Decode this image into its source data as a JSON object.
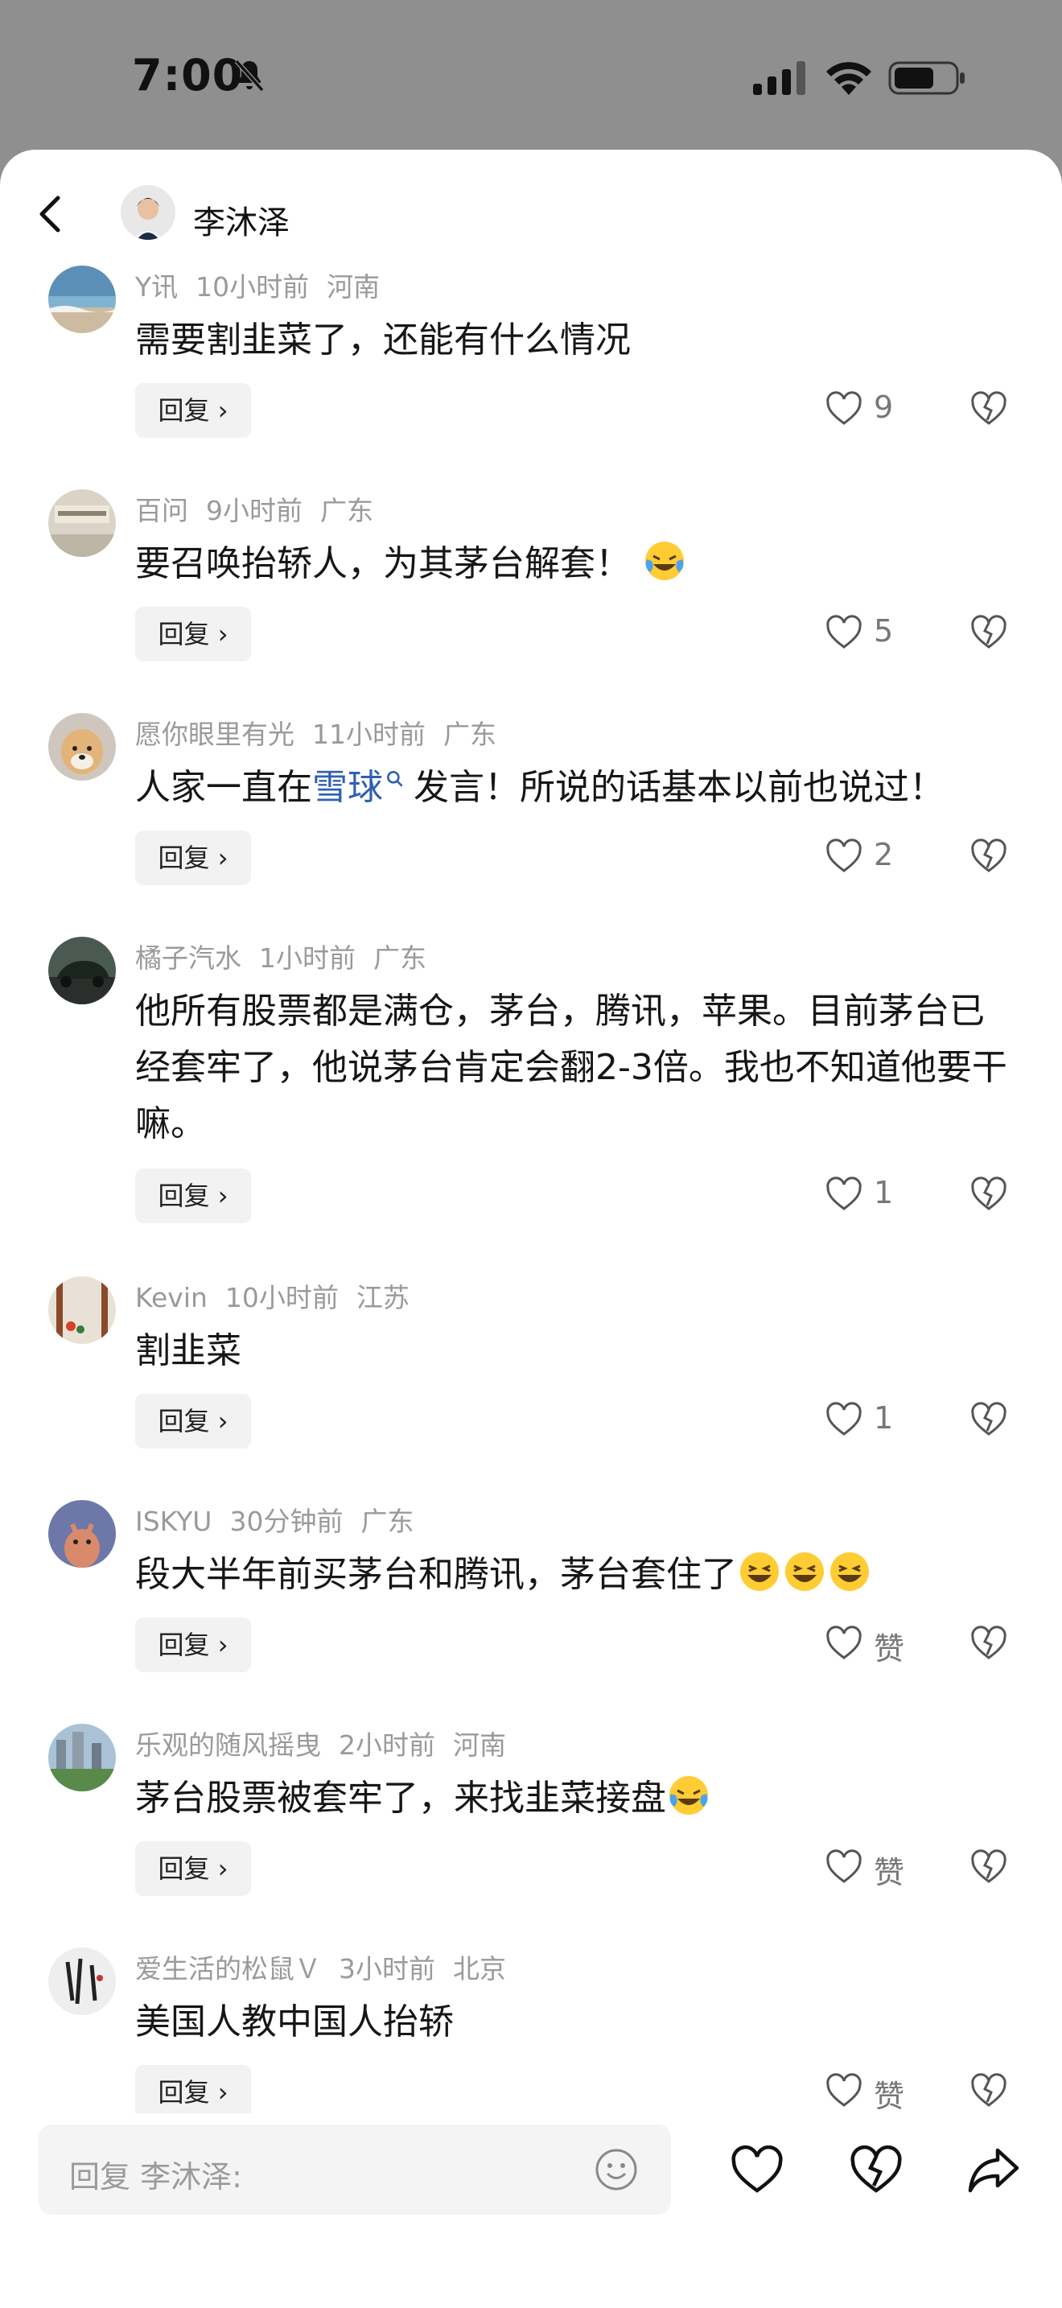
{
  "status": {
    "time": "7:00"
  },
  "header": {
    "name": "李沐泽"
  },
  "comments": [
    {
      "user": "Y讯",
      "time": "10小时前",
      "region": "河南",
      "text": "需要割韭菜了，还能有什么情况",
      "likes": "9"
    },
    {
      "user": "百问",
      "time": "9小时前",
      "region": "广东",
      "text": "要召唤抬轿人，为其茅台解套！",
      "likes": "5"
    },
    {
      "user": "愿你眼里有光",
      "time": "11小时前",
      "region": "广东",
      "text_a": "人家一直在",
      "link": "雪球",
      "text_b": "发言！所说的话基本以前也说过！",
      "likes": "2"
    },
    {
      "user": "橘子汽水",
      "time": "1小时前",
      "region": "广东",
      "text": "他所有股票都是满仓，茅台，腾讯，苹果。目前茅台已经套牢了，他说茅台肯定会翻2-3倍。我也不知道他要干嘛。",
      "likes": "1"
    },
    {
      "user": "Kevin",
      "time": "10小时前",
      "region": "江苏",
      "text": "割韭菜",
      "likes": "1"
    },
    {
      "user": "ISKYU",
      "time": "30分钟前",
      "region": "广东",
      "text": "段大半年前买茅台和腾讯，茅台套住了",
      "likes": "赞"
    },
    {
      "user": "乐观的随风摇曳",
      "time": "2小时前",
      "region": "河南",
      "text": "茅台股票被套牢了，来找韭菜接盘",
      "likes": "赞"
    },
    {
      "user": "爱生活的松鼠Ｖ",
      "time": "3小时前",
      "region": "北京",
      "text": "美国人教中国人抬轿",
      "likes": "赞"
    }
  ],
  "reply_label": "回复",
  "input": {
    "placeholder": "回复 李沐泽:"
  }
}
